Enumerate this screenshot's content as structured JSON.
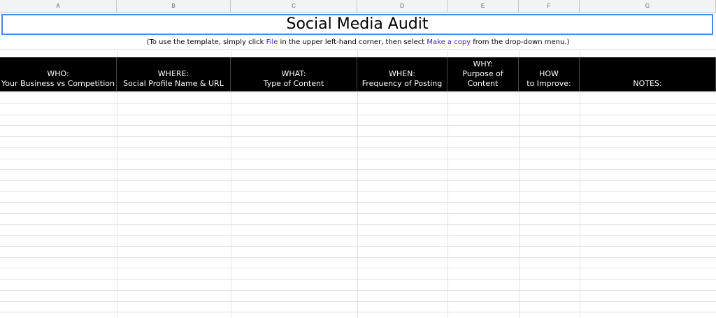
{
  "columns": [
    "A",
    "B",
    "C",
    "D",
    "E",
    "F",
    "G"
  ],
  "title": "Social Media Audit",
  "instructions": {
    "prefix": "(To use the template, simply click ",
    "link1": "File",
    "middle": " in the upper left-hand corner, then select ",
    "link2": "Make a copy",
    "suffix": " from the drop-down menu.)"
  },
  "headers": [
    {
      "lines": [
        "WHO:",
        "Your Business vs Competition"
      ]
    },
    {
      "lines": [
        "WHERE:",
        "Social Profile Name & URL"
      ]
    },
    {
      "lines": [
        "WHAT:",
        "Type of Content"
      ]
    },
    {
      "lines": [
        "WHEN:",
        "Frequency of Posting"
      ]
    },
    {
      "lines": [
        "WHY:",
        "Purpose of",
        "Content"
      ]
    },
    {
      "lines": [
        "HOW",
        "to Improve:"
      ]
    },
    {
      "lines": [
        "NOTES:"
      ]
    }
  ],
  "colors": {
    "title_border": "#4a86e8",
    "link": "#3c1fd6",
    "header_bg": "#000000",
    "header_text": "#ffffff"
  }
}
